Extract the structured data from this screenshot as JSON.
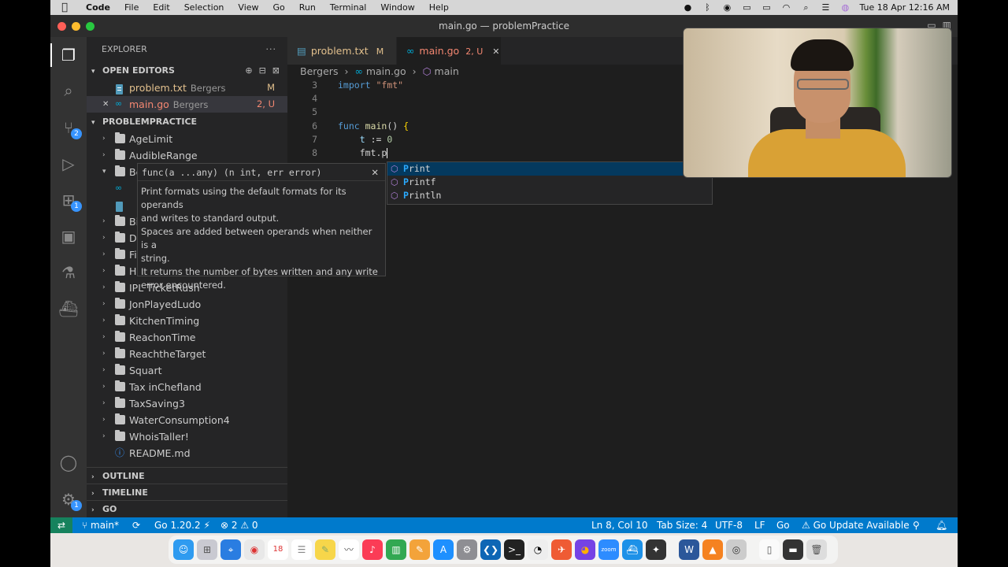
{
  "menubar": {
    "apple": "",
    "items": [
      "Code",
      "File",
      "Edit",
      "Selection",
      "View",
      "Go",
      "Run",
      "Terminal",
      "Window",
      "Help"
    ],
    "clock": "Tue 18 Apr  12:16 AM"
  },
  "window": {
    "title": "main.go — problemPractice"
  },
  "explorer": {
    "title": "EXPLORER",
    "more": "···",
    "open_editors_label": "OPEN EDITORS",
    "open_editors": [
      {
        "name": "problem.txt",
        "folder": "Bergers",
        "status": "M",
        "color": "#e2c08d"
      },
      {
        "name": "main.go",
        "folder": "Bergers",
        "status": "2, U",
        "color": "#f48771"
      }
    ],
    "project_label": "PROBLEMPRACTICE",
    "folders_top": [
      {
        "name": "AgeLimit"
      },
      {
        "name": "AudibleRange"
      },
      {
        "name": "Be",
        "open": true
      }
    ],
    "folders_hidden": [
      {
        "name": "Bi"
      },
      {
        "name": "D"
      },
      {
        "name": "Fi"
      },
      {
        "name": "H"
      }
    ],
    "folders_bottom": [
      {
        "name": "IPL TicketRush"
      },
      {
        "name": "JonPlayedLudo"
      },
      {
        "name": "KitchenTiming"
      },
      {
        "name": "ReachonTime"
      },
      {
        "name": "ReachtheTarget"
      },
      {
        "name": "Squart"
      },
      {
        "name": "Tax inChefland"
      },
      {
        "name": "TaxSaving3"
      },
      {
        "name": "WaterConsumption4"
      },
      {
        "name": "WhoisTaller!"
      }
    ],
    "readme": "README.md",
    "outline_label": "OUTLINE",
    "timeline_label": "TIMELINE",
    "go_label": "GO"
  },
  "tabs": [
    {
      "name": "problem.txt",
      "status": "M"
    },
    {
      "name": "main.go",
      "status": "2, U",
      "close": "✕"
    }
  ],
  "breadcrumbs": [
    "Bergers",
    "main.go",
    "main"
  ],
  "code": {
    "lines": [
      {
        "n": "3",
        "parts": [
          {
            "t": "import ",
            "c": "kw"
          },
          {
            "t": "\"fmt\"",
            "c": "str"
          }
        ]
      },
      {
        "n": "4",
        "parts": []
      },
      {
        "n": "5",
        "parts": []
      },
      {
        "n": "6",
        "parts": [
          {
            "t": "func ",
            "c": "kw"
          },
          {
            "t": "main",
            "c": "fn"
          },
          {
            "t": "() ",
            "c": ""
          },
          {
            "t": "{",
            "c": "br"
          }
        ]
      },
      {
        "n": "7",
        "parts": [
          {
            "t": "    ",
            "c": ""
          },
          {
            "t": "t",
            "c": "var"
          },
          {
            "t": " := ",
            "c": ""
          },
          {
            "t": "0",
            "c": "num"
          }
        ]
      },
      {
        "n": "8",
        "parts": [
          {
            "t": "    fmt.p",
            "c": ""
          }
        ]
      }
    ]
  },
  "suggest": {
    "items": [
      {
        "match": "P",
        "rest": "rint"
      },
      {
        "match": "P",
        "rest": "rintf"
      },
      {
        "match": "P",
        "rest": "rintln"
      }
    ]
  },
  "hover": {
    "signature": "func(a ...any) (n int, err error)",
    "close": "✕",
    "doc": [
      "Print formats using the default formats for its operands",
      "and writes to standard output.",
      "Spaces are added between operands when neither is a",
      "string.",
      "It returns the number of bytes written and any write",
      "error encountered."
    ]
  },
  "statusbar": {
    "branch": "main*",
    "go_version": "Go 1.20.2",
    "errors": "2",
    "warnings": "0",
    "position": "Ln 8, Col 10",
    "tab_size": "Tab Size: 4",
    "encoding": "UTF-8",
    "eol": "LF",
    "language": "Go",
    "update": "Go Update Available"
  },
  "dock": {
    "calendar_day": "18"
  }
}
